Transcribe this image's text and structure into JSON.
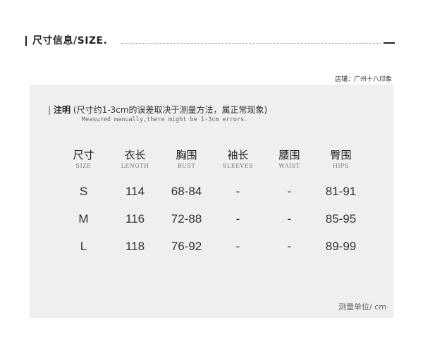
{
  "header": {
    "bar": "|",
    "title": "尺寸信息/SIZE."
  },
  "shop": "店铺：广州十八印象",
  "note": {
    "bar": "|",
    "label": "注明",
    "text": "(尺寸约1-3cm的误差取决于测量方法，属正常现象)",
    "english": "Measured manually,there might be 1-3cm errors."
  },
  "table": {
    "columns": [
      {
        "cn": "尺寸",
        "en": "SIZE"
      },
      {
        "cn": "衣长",
        "en": "LENGTH"
      },
      {
        "cn": "胸围",
        "en": "BUST"
      },
      {
        "cn": "袖长",
        "en": "SLEEVES"
      },
      {
        "cn": "腰围",
        "en": "WAIST"
      },
      {
        "cn": "臀围",
        "en": "HIPS"
      }
    ],
    "rows": [
      [
        "S",
        "114",
        "68-84",
        "-",
        "-",
        "81-91"
      ],
      [
        "M",
        "116",
        "72-88",
        "-",
        "-",
        "85-95"
      ],
      [
        "L",
        "118",
        "76-92",
        "-",
        "-",
        "89-99"
      ]
    ]
  },
  "unit": "测量单位/ cm"
}
